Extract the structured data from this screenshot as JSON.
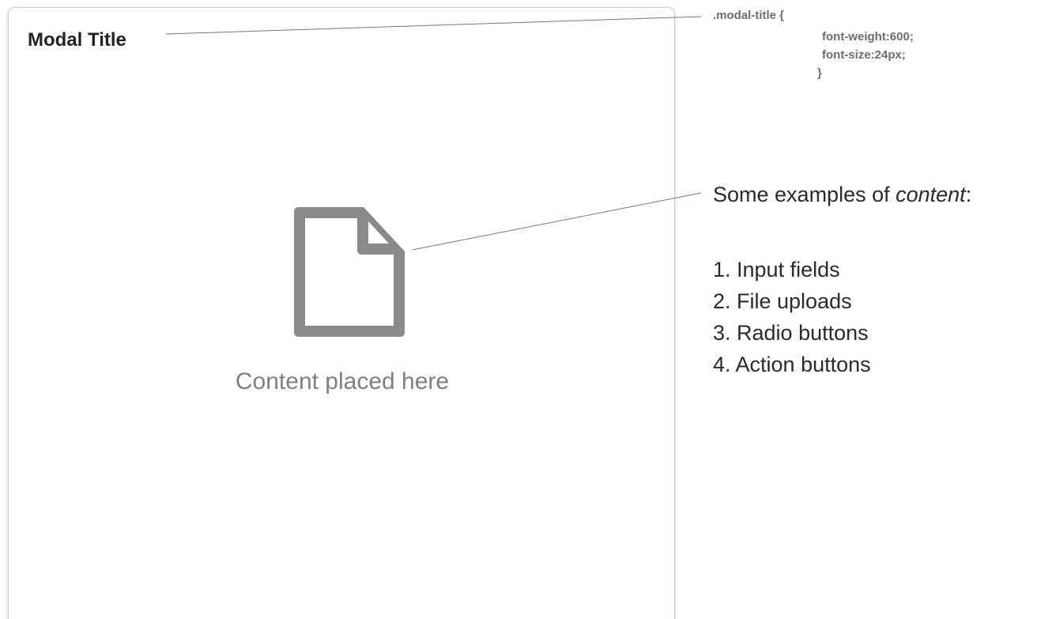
{
  "modal": {
    "title": "Modal Title",
    "content_caption": "Content placed here",
    "content_icon": "document-icon"
  },
  "code_note": {
    "line1": ".modal-title {",
    "line2": "font-weight:600;",
    "line3": "font-size:24px;",
    "line4": "}"
  },
  "examples": {
    "heading_prefix": "Some examples of ",
    "heading_emphasis": "content",
    "heading_suffix": ":",
    "items": [
      "1. Input fields",
      "2. File uploads",
      "3. Radio buttons",
      "4. Action buttons"
    ]
  },
  "colors": {
    "title_text": "#222222",
    "icon_fill": "#8a8a8a",
    "caption_text": "#808080",
    "code_text": "#6e6e6e",
    "border": "#cfcfcf"
  }
}
